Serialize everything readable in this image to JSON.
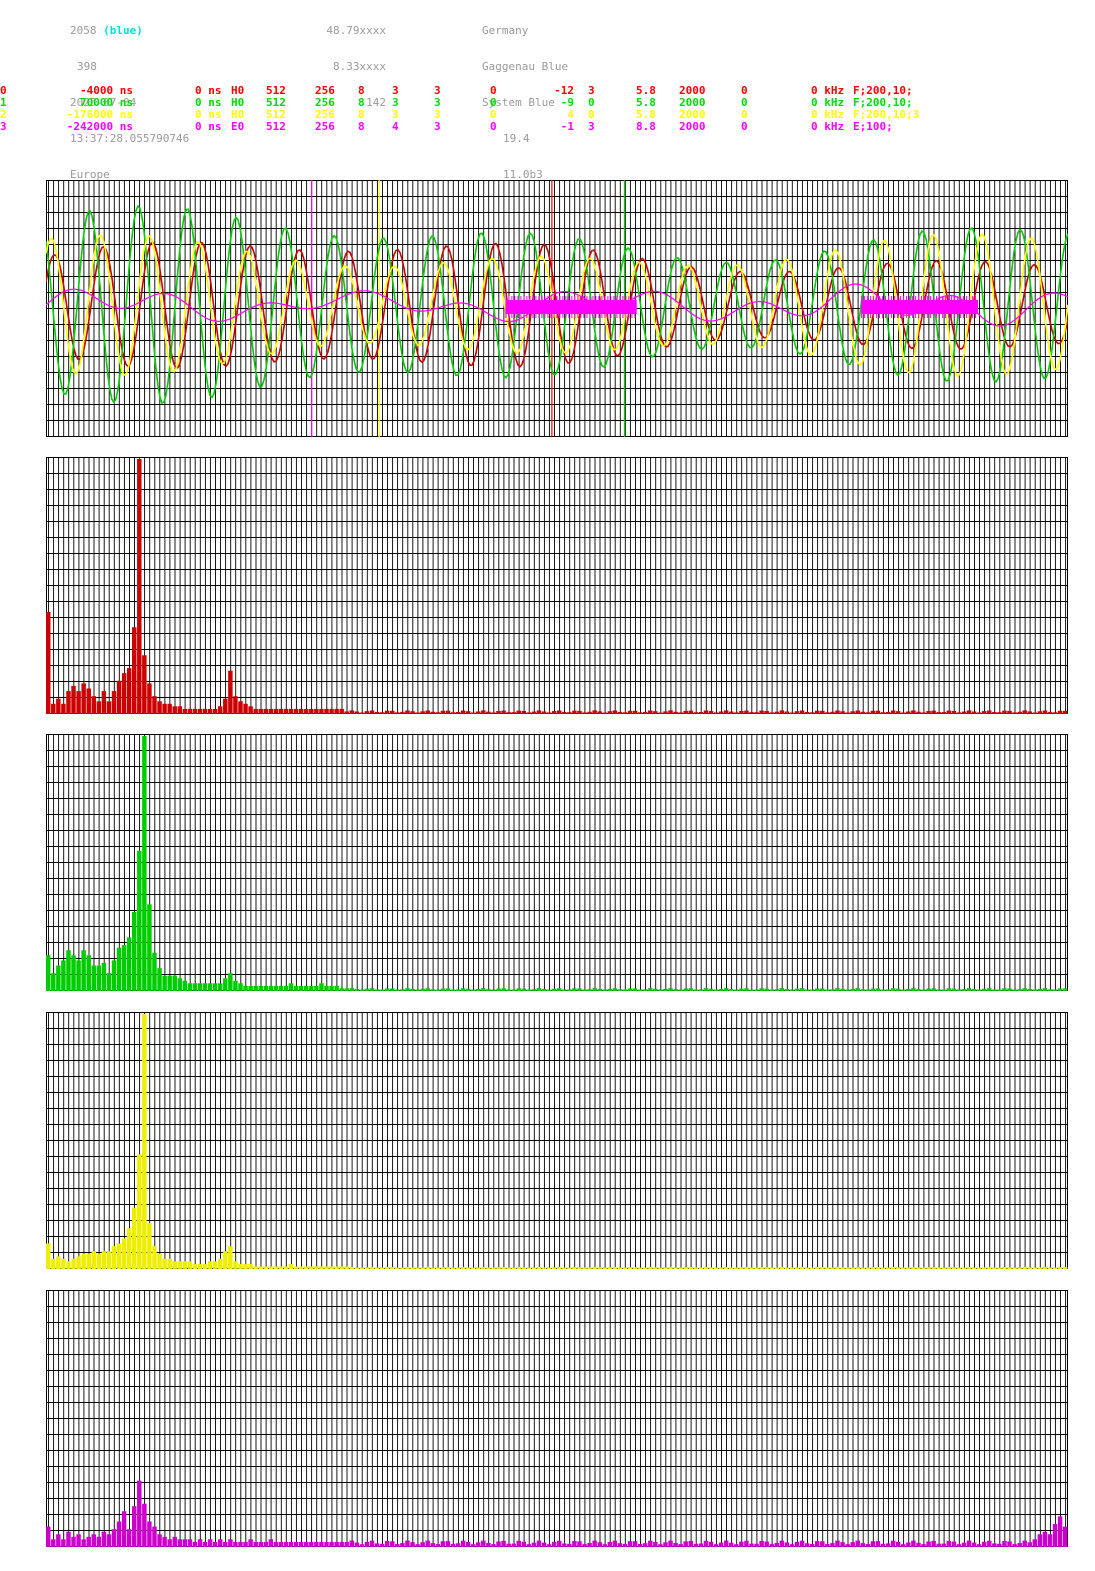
{
  "header": {
    "station_id": "2058",
    "station_tag": "(blue)",
    "line2": "398",
    "date": "2025-07-04",
    "time": "13:37:28.055790746",
    "region": "Europe",
    "lat": "48.79xxxx",
    "lon": "8.33xxxx",
    "alt": "142",
    "country": "Germany",
    "location": "Gaggenau Blue",
    "system": "System Blue",
    "v1": "19.4",
    "v2": "11.0b3"
  },
  "channels": [
    {
      "id": "0",
      "offset": "-4000 ns",
      "delay": "0 ns",
      "mode": "H0",
      "f1": "512",
      "f2": "256",
      "f3": "8",
      "f4": "3",
      "f5": "3",
      "f6": "0",
      "f7": "-12",
      "f8": "3",
      "f9": "5.8",
      "f10": "2000",
      "f11": "0",
      "f12": "0 kHz",
      "filter": "F;200,10;",
      "color": "#ff0000"
    },
    {
      "id": "1",
      "offset": "70000 ns",
      "delay": "0 ns",
      "mode": "H0",
      "f1": "512",
      "f2": "256",
      "f3": "8",
      "f4": "3",
      "f5": "3",
      "f6": "0",
      "f7": "-9",
      "f8": "0",
      "f9": "5.8",
      "f10": "2000",
      "f11": "0",
      "f12": "0 kHz",
      "filter": "F;200,10;",
      "color": "#00dd00"
    },
    {
      "id": "2",
      "offset": "-176000 ns",
      "delay": "0 ns",
      "mode": "H0",
      "f1": "512",
      "f2": "256",
      "f3": "8",
      "f4": "3",
      "f5": "3",
      "f6": "0",
      "f7": "4",
      "f8": "0",
      "f9": "5.8",
      "f10": "2000",
      "f11": "0",
      "f12": "0 kHz",
      "filter": "F;200,10;3",
      "color": "#ffff00"
    },
    {
      "id": "3",
      "offset": "-242000 ns",
      "delay": "0 ns",
      "mode": "E0",
      "f1": "512",
      "f2": "256",
      "f3": "8",
      "f4": "4",
      "f5": "3",
      "f6": "0",
      "f7": "-1",
      "f8": "3",
      "f9": "8.8",
      "f10": "2000",
      "f11": "0",
      "f12": "0 kHz",
      "filter": "E;100;",
      "color": "#ff00ff"
    }
  ],
  "colors": {
    "grid": "#000000",
    "background": "#ffffff",
    "bar_red": "#cc0000",
    "bar_green": "#00cc00",
    "bar_yellow": "#eeee00",
    "bar_magenta": "#cc00cc",
    "marker_magenta": "#ff00ff"
  },
  "chart_data": [
    {
      "type": "line",
      "series": [
        {
          "name": "0",
          "color": "#cc0000",
          "period_px": 49,
          "amplitude": 0.38,
          "phase": 0.5
        },
        {
          "name": "1",
          "color": "#00cc00",
          "period_px": 49,
          "amplitude": 0.55,
          "phase": 2.3
        },
        {
          "name": "2",
          "color": "#ffff00",
          "period_px": 49,
          "amplitude": 0.42,
          "phase": 0.9
        },
        {
          "name": "3",
          "color": "#ff00ff",
          "period_px": 98,
          "amplitude": 0.08,
          "phase": 0.0
        }
      ],
      "markers": [
        {
          "color": "#ff00ff",
          "at": 0.26
        },
        {
          "color": "#ffff00",
          "at": 0.326
        },
        {
          "color": "#ff0000",
          "at": 0.495
        },
        {
          "color": "#00cc00",
          "at": 0.566
        }
      ],
      "bursts": [
        {
          "color": "#ff00ff",
          "from": 0.45,
          "to": 0.578
        },
        {
          "color": "#ff00ff",
          "from": 0.798,
          "to": 0.912
        }
      ],
      "grid": true
    },
    {
      "type": "bar",
      "series": [
        {
          "name": "0",
          "color": "#cc0000"
        }
      ],
      "values": [
        0.4,
        0.04,
        0.06,
        0.04,
        0.09,
        0.11,
        0.09,
        0.12,
        0.1,
        0.07,
        0.05,
        0.09,
        0.05,
        0.09,
        0.13,
        0.16,
        0.18,
        0.34,
        1.0,
        0.23,
        0.12,
        0.07,
        0.05,
        0.04,
        0.04,
        0.03,
        0.03,
        0.02,
        0.02,
        0.02,
        0.02,
        0.02,
        0.02,
        0.02,
        0.03,
        0.06,
        0.17,
        0.07,
        0.05,
        0.04,
        0.03,
        0.02,
        0.02,
        0.02,
        0.02,
        0.02,
        0.02,
        0.02,
        0.02,
        0.02,
        0.02,
        0.02,
        0.02,
        0.02,
        0.02,
        0.02,
        0.02,
        0.02,
        0.02,
        0.01
      ],
      "tail": 0.01,
      "grid": true
    },
    {
      "type": "bar",
      "series": [
        {
          "name": "1",
          "color": "#00cc00"
        }
      ],
      "values": [
        0.14,
        0.07,
        0.1,
        0.12,
        0.16,
        0.14,
        0.12,
        0.16,
        0.14,
        0.1,
        0.1,
        0.11,
        0.07,
        0.12,
        0.17,
        0.18,
        0.21,
        0.31,
        0.55,
        1.0,
        0.34,
        0.15,
        0.09,
        0.06,
        0.06,
        0.06,
        0.05,
        0.04,
        0.03,
        0.03,
        0.03,
        0.03,
        0.03,
        0.03,
        0.03,
        0.05,
        0.07,
        0.04,
        0.03,
        0.02,
        0.02,
        0.02,
        0.02,
        0.02,
        0.02,
        0.02,
        0.02,
        0.02,
        0.03,
        0.02,
        0.02,
        0.02,
        0.02,
        0.02,
        0.03,
        0.02,
        0.02,
        0.02,
        0.01,
        0.01
      ],
      "tail": 0.008,
      "grid": true
    },
    {
      "type": "bar",
      "series": [
        {
          "name": "2",
          "color": "#eeee00"
        }
      ],
      "values": [
        0.1,
        0.04,
        0.05,
        0.04,
        0.03,
        0.04,
        0.05,
        0.06,
        0.06,
        0.07,
        0.06,
        0.07,
        0.07,
        0.09,
        0.1,
        0.12,
        0.16,
        0.24,
        0.45,
        1.0,
        0.18,
        0.09,
        0.06,
        0.04,
        0.04,
        0.03,
        0.03,
        0.03,
        0.03,
        0.02,
        0.02,
        0.02,
        0.03,
        0.03,
        0.04,
        0.07,
        0.09,
        0.03,
        0.02,
        0.02,
        0.02,
        0.01,
        0.01,
        0.01,
        0.01,
        0.01,
        0.01,
        0.01,
        0.02,
        0.01,
        0.01,
        0.01,
        0.01,
        0.01,
        0.01,
        0.01,
        0.01,
        0.01,
        0.01,
        0.01
      ],
      "tail": 0.006,
      "grid": true
    },
    {
      "type": "bar",
      "series": [
        {
          "name": "3",
          "color": "#cc00cc"
        }
      ],
      "values": [
        0.08,
        0.03,
        0.05,
        0.03,
        0.06,
        0.04,
        0.05,
        0.03,
        0.04,
        0.05,
        0.04,
        0.06,
        0.05,
        0.07,
        0.1,
        0.14,
        0.07,
        0.16,
        0.26,
        0.17,
        0.1,
        0.08,
        0.05,
        0.04,
        0.03,
        0.04,
        0.03,
        0.03,
        0.03,
        0.02,
        0.03,
        0.02,
        0.03,
        0.02,
        0.03,
        0.02,
        0.03,
        0.02,
        0.02,
        0.02,
        0.03,
        0.02,
        0.02,
        0.02,
        0.03,
        0.02,
        0.02,
        0.02,
        0.02,
        0.02,
        0.02,
        0.02,
        0.02,
        0.02,
        0.02,
        0.02,
        0.02,
        0.02,
        0.02,
        0.02
      ],
      "tail": 0.018,
      "tail_end": [
        0.03,
        0.05,
        0.06,
        0.05,
        0.09,
        0.12,
        0.08
      ],
      "grid": true
    }
  ]
}
